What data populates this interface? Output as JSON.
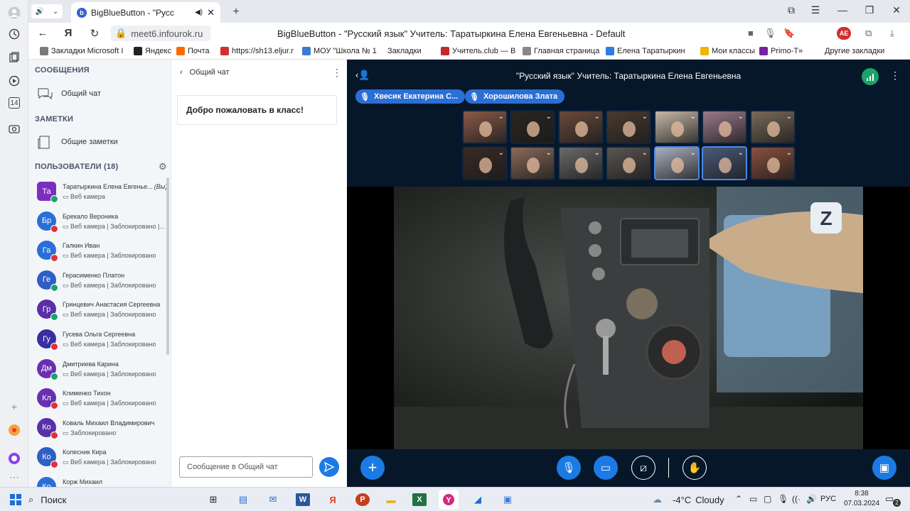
{
  "browser": {
    "tab_title": "BigBlueButton - \"Русс",
    "url": "meet6.infourok.ru",
    "page_title": "BigBlueButton - \"Русский язык\" Учитель: Таратыркина Елена Евгеньевна - Default",
    "profile_badge": "AE",
    "profile_count": "3",
    "rail_badge": "14"
  },
  "bookmarks": [
    {
      "label": "Закладки Microsoft I",
      "color": "#7a7a7a"
    },
    {
      "label": "Яндекс",
      "color": "#222222"
    },
    {
      "label": "Почта",
      "color": "#ff6a00"
    },
    {
      "label": "https://sh13.eljur.r",
      "color": "#d32f2f"
    },
    {
      "label": "МОУ \"Школа № 1",
      "color": "#3a7bd5"
    },
    {
      "label": "Закладки",
      "color": "#00000000"
    },
    {
      "label": "Учитель.club — В",
      "color": "#c62828"
    },
    {
      "label": "Главная страница",
      "color": "#888888"
    },
    {
      "label": "Елена Таратыркин",
      "color": "#2d7be5"
    },
    {
      "label": "Мои классы",
      "color": "#f0b400"
    },
    {
      "label": "Primo-T",
      "color": "#7b1fa2"
    },
    {
      "label": "Другие закладки",
      "color": "#00000000"
    }
  ],
  "sidebar": {
    "messages_header": "СООБЩЕНИЯ",
    "public_chat": "Общий чат",
    "notes_header": "ЗАМЕТКИ",
    "shared_notes": "Общие заметки",
    "users_header": "ПОЛЬЗОВАТЕЛИ (18)"
  },
  "users": [
    {
      "initials": "Та",
      "name": "Таратыркина Елена Евгенье...",
      "suffix": "(Вы)",
      "status": "Веб камера",
      "avatar": "#7b2fbf",
      "dot": "#1aa36b"
    },
    {
      "initials": "Бр",
      "name": "Брекало Вероника",
      "status": "Веб камера | Заблокировано |...",
      "avatar": "#2a6fd6",
      "dot": "#e0303c"
    },
    {
      "initials": "Га",
      "name": "Галкин Иван",
      "status": "Веб камера | Заблокировано",
      "avatar": "#2a6fd6",
      "dot": "#e0303c"
    },
    {
      "initials": "Ге",
      "name": "Герасименко Платон",
      "status": "Веб камера | Заблокировано",
      "avatar": "#2f5fc4",
      "dot": "#1aa36b"
    },
    {
      "initials": "Гр",
      "name": "Гринцевич Анастасия Сергеевна",
      "status": "Веб камера | Заблокировано",
      "avatar": "#5a2fa8",
      "dot": "#1aa36b"
    },
    {
      "initials": "Гу",
      "name": "Гусева Ольга Сергеевна",
      "status": "Веб камера | Заблокировано",
      "avatar": "#3a2fa0",
      "dot": "#e0303c"
    },
    {
      "initials": "Дм",
      "name": "Дмитриева Карина",
      "status": "Веб камера | Заблокировано",
      "avatar": "#6a2fb0",
      "dot": "#1aa36b"
    },
    {
      "initials": "Кл",
      "name": "Клименко Тихон",
      "status": "Веб камера | Заблокировано",
      "avatar": "#6a2fb0",
      "dot": "#e0303c"
    },
    {
      "initials": "Ко",
      "name": "Коваль Михаил Владимирович",
      "status": "Заблокировано",
      "avatar": "#5a2fa8",
      "dot": "#e0303c"
    },
    {
      "initials": "Ко",
      "name": "Колесник Кира",
      "status": "Веб камера | Заблокировано",
      "avatar": "#2f5fc4",
      "dot": "#e0303c"
    },
    {
      "initials": "Ко",
      "name": "Корж Михаил",
      "status": "",
      "avatar": "#2a6fd6",
      "dot": "#1aa36b"
    }
  ],
  "chat": {
    "title": "Общий чат",
    "welcome": "Добро пожаловать в класс!",
    "placeholder": "Сообщение в Общий чат"
  },
  "meeting": {
    "title": "\"Русский язык\" Учитель: Таратыркина Елена Евгеньевна",
    "talkers": [
      "Хвесик Екатерина С...",
      "Хорошилова Злата"
    ]
  },
  "thumbs": [
    "#8a5a4a",
    "#2a2520",
    "#6a4a3a",
    "#4a3a30",
    "#c8b8a8",
    "#9a7a8a",
    "#7a6a5a",
    "#3a2a25",
    "#8a6a5a",
    "#6a6a6a",
    "#5a5550",
    "#a8b0c0",
    "#4a5a7a",
    "#8a5040"
  ],
  "taskbar": {
    "search": "Поиск",
    "temp": "-4°C",
    "weather": "Cloudy",
    "lang": "РУС",
    "time": "8:38",
    "date": "07.03.2024",
    "notif": "2"
  }
}
